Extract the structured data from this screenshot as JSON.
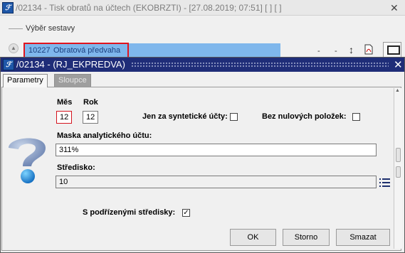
{
  "main_window": {
    "title": "/02134 - Tisk obratů na účtech (EKOBRZTI) - [27.08.2019; 07:51]  [  ]  [  ]",
    "close_glyph": "✕",
    "section_label": "Výběr sestavy",
    "selected_report": {
      "code": "10227",
      "name": "Obratová předvaha"
    },
    "toolbar_dashes": [
      "-",
      "-"
    ],
    "toolbar_icons": [
      "sort-arrows-icon",
      "pdf-icon",
      "monitor-icon"
    ]
  },
  "dialog": {
    "title": "/02134 - (RJ_EKPREDVA)",
    "close_glyph": "✕",
    "tabs": [
      {
        "label": "Parametry",
        "active": true
      },
      {
        "label": "Sloupce",
        "active": false
      }
    ],
    "fields": {
      "mes_label": "Měs",
      "mes_value": "12",
      "rok_label": "Rok",
      "rok_value": "12",
      "synteticke_label": "Jen za syntetické účty:",
      "synteticke_checked": false,
      "nulove_label": "Bez nulových položek:",
      "nulove_checked": false,
      "maska_label": "Maska analytického účtu:",
      "maska_value": "311%",
      "stredisko_label": "Středisko:",
      "stredisko_value": "10",
      "podrizene_label": "S podřízenými středisky:",
      "podrizene_checked": true,
      "check_glyph": "✓"
    },
    "buttons": {
      "ok": "OK",
      "storno": "Storno",
      "smazat": "Smazat"
    }
  },
  "colors": {
    "dialog_titlebar": "#1f2d78",
    "selection_row": "#7fb7ec",
    "highlight_border": "#e0141e"
  }
}
